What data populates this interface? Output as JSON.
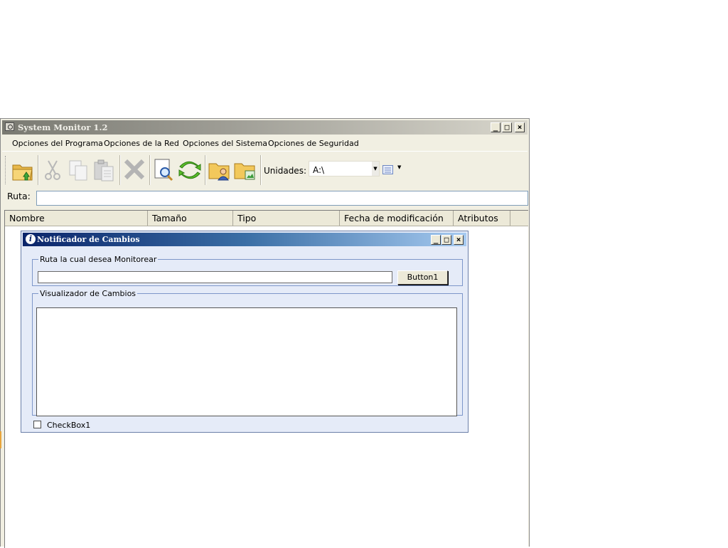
{
  "main_window": {
    "title": "System Monitor 1.2",
    "controls": {
      "minimize": "_",
      "maximize": "□",
      "close": "×"
    }
  },
  "menu": {
    "items": [
      {
        "label": "Opciones del Programa"
      },
      {
        "label": "Opciones de la Red"
      },
      {
        "label": "Opciones del Sistema"
      },
      {
        "label": "Opciones de Seguridad"
      }
    ]
  },
  "toolbar": {
    "buttons": [
      "open-folder-icon",
      "cut-icon",
      "copy-icon",
      "paste-icon",
      "delete-icon",
      "search-icon",
      "refresh-icon",
      "user-folder-icon",
      "folder-image-icon"
    ],
    "drives_label": "Unidades:",
    "drive_value": "A:\\"
  },
  "path": {
    "label": "Ruta:",
    "value": ""
  },
  "file_list": {
    "columns": [
      "Nombre",
      "Tamaño",
      "Tipo",
      "Fecha de modificación",
      "Atributos"
    ]
  },
  "child_window": {
    "title": "Notificador de Cambios",
    "monitor_group_label": "Ruta la cual desea Monitorear",
    "monitor_path_value": "",
    "button_label": "Button1",
    "changes_group_label": "Visualizador de Cambios",
    "checkbox_label": "CheckBox1"
  },
  "colors": {
    "main_title_gradient": [
      "#7a7a72",
      "#d8d6cc"
    ],
    "child_title_gradient": [
      "#0a246a",
      "#a6caf0"
    ],
    "window_face": "#f1efe2",
    "child_face": "#e5ebf8"
  }
}
